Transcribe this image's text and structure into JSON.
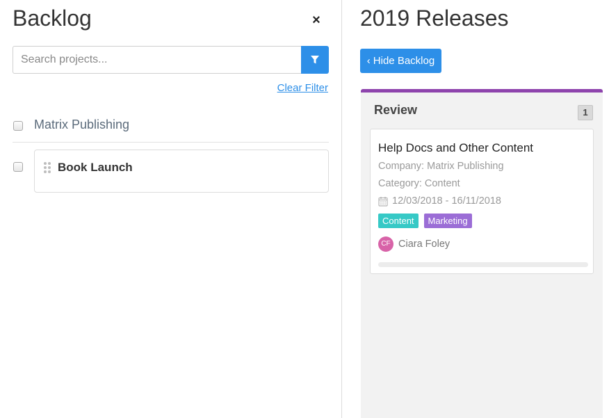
{
  "backlog": {
    "title": "Backlog",
    "close_symbol": "×",
    "search_placeholder": "Search projects...",
    "filter_icon": "filter-icon",
    "clear_filter_label": "Clear Filter",
    "group": {
      "label": "Matrix Publishing",
      "checked": false
    },
    "items": [
      {
        "label": "Book Launch",
        "checked": false
      }
    ]
  },
  "releases": {
    "title": "2019 Releases",
    "hide_backlog_label": "Hide Backlog",
    "hide_backlog_icon": "chevron-left-icon",
    "column": {
      "title": "Review",
      "count": "1",
      "accent_color": "#8e44ad",
      "cards": [
        {
          "title": "Help Docs and Other Content",
          "company": "Company: Matrix Publishing",
          "category": "Category: Content",
          "dates": "12/03/2018 - 16/11/2018",
          "tags": [
            {
              "label": "Content",
              "color": "#36c9c6"
            },
            {
              "label": "Marketing",
              "color": "#9b6dd6"
            }
          ],
          "assignee": {
            "initials": "CF",
            "name": "Ciara Foley",
            "avatar_color": "#d863a8"
          },
          "progress": 0
        }
      ]
    }
  },
  "colors": {
    "primary": "#2d8fe8"
  }
}
